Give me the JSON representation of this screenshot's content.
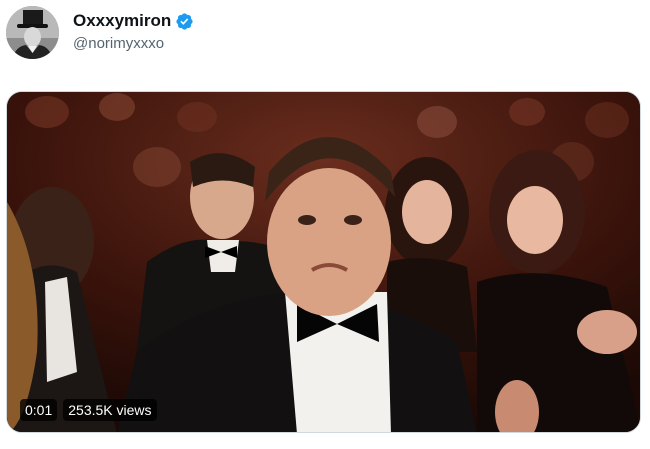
{
  "author": {
    "display_name": "Oxxxymiron",
    "handle": "@norimyxxxo",
    "verified": true,
    "verified_color": "#1d9bf0",
    "avatar_icon": "avatar-photo"
  },
  "media": {
    "type": "video",
    "timestamp": "0:01",
    "views": "253.5K views",
    "thumbnail_icon": "video-frame-audience-applause"
  }
}
